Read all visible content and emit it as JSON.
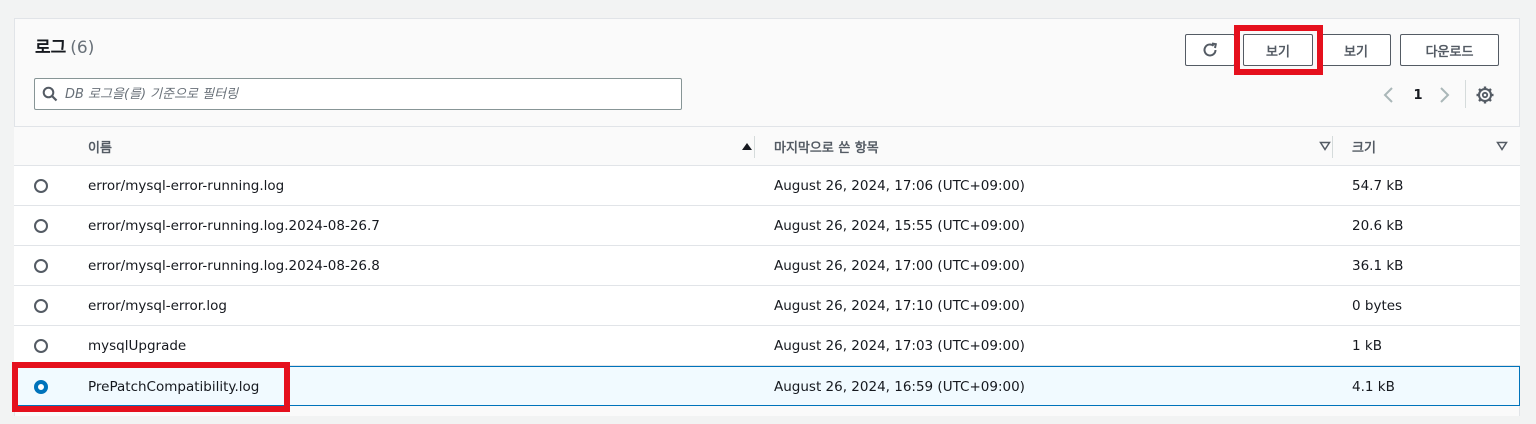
{
  "header": {
    "title": "로그",
    "count": "(6)"
  },
  "toolbar": {
    "refresh_icon": "refresh-icon",
    "view_label_1": "보기",
    "view_label_2": "보기",
    "download_label": "다운로드"
  },
  "search": {
    "placeholder": "DB 로그을(를) 기준으로 필터링",
    "value": ""
  },
  "pagination": {
    "page": "1"
  },
  "table": {
    "columns": {
      "name": "이름",
      "last_written": "마지막으로 쓴 항목",
      "size": "크기"
    },
    "rows": [
      {
        "name": "error/mysql-error-running.log",
        "last_written": "August 26, 2024, 17:06 (UTC+09:00)",
        "size": "54.7 kB",
        "selected": false
      },
      {
        "name": "error/mysql-error-running.log.2024-08-26.7",
        "last_written": "August 26, 2024, 15:55 (UTC+09:00)",
        "size": "20.6 kB",
        "selected": false
      },
      {
        "name": "error/mysql-error-running.log.2024-08-26.8",
        "last_written": "August 26, 2024, 17:00 (UTC+09:00)",
        "size": "36.1 kB",
        "selected": false
      },
      {
        "name": "error/mysql-error.log",
        "last_written": "August 26, 2024, 17:10 (UTC+09:00)",
        "size": "0 bytes",
        "selected": false
      },
      {
        "name": "mysqlUpgrade",
        "last_written": "August 26, 2024, 17:03 (UTC+09:00)",
        "size": "1 kB",
        "selected": false
      },
      {
        "name": "PrePatchCompatibility.log",
        "last_written": "August 26, 2024, 16:59 (UTC+09:00)",
        "size": "4.1 kB",
        "selected": true
      }
    ]
  },
  "colors": {
    "highlight": "#e5101d",
    "accent": "#0073bb",
    "selected_bg": "#f1faff"
  }
}
